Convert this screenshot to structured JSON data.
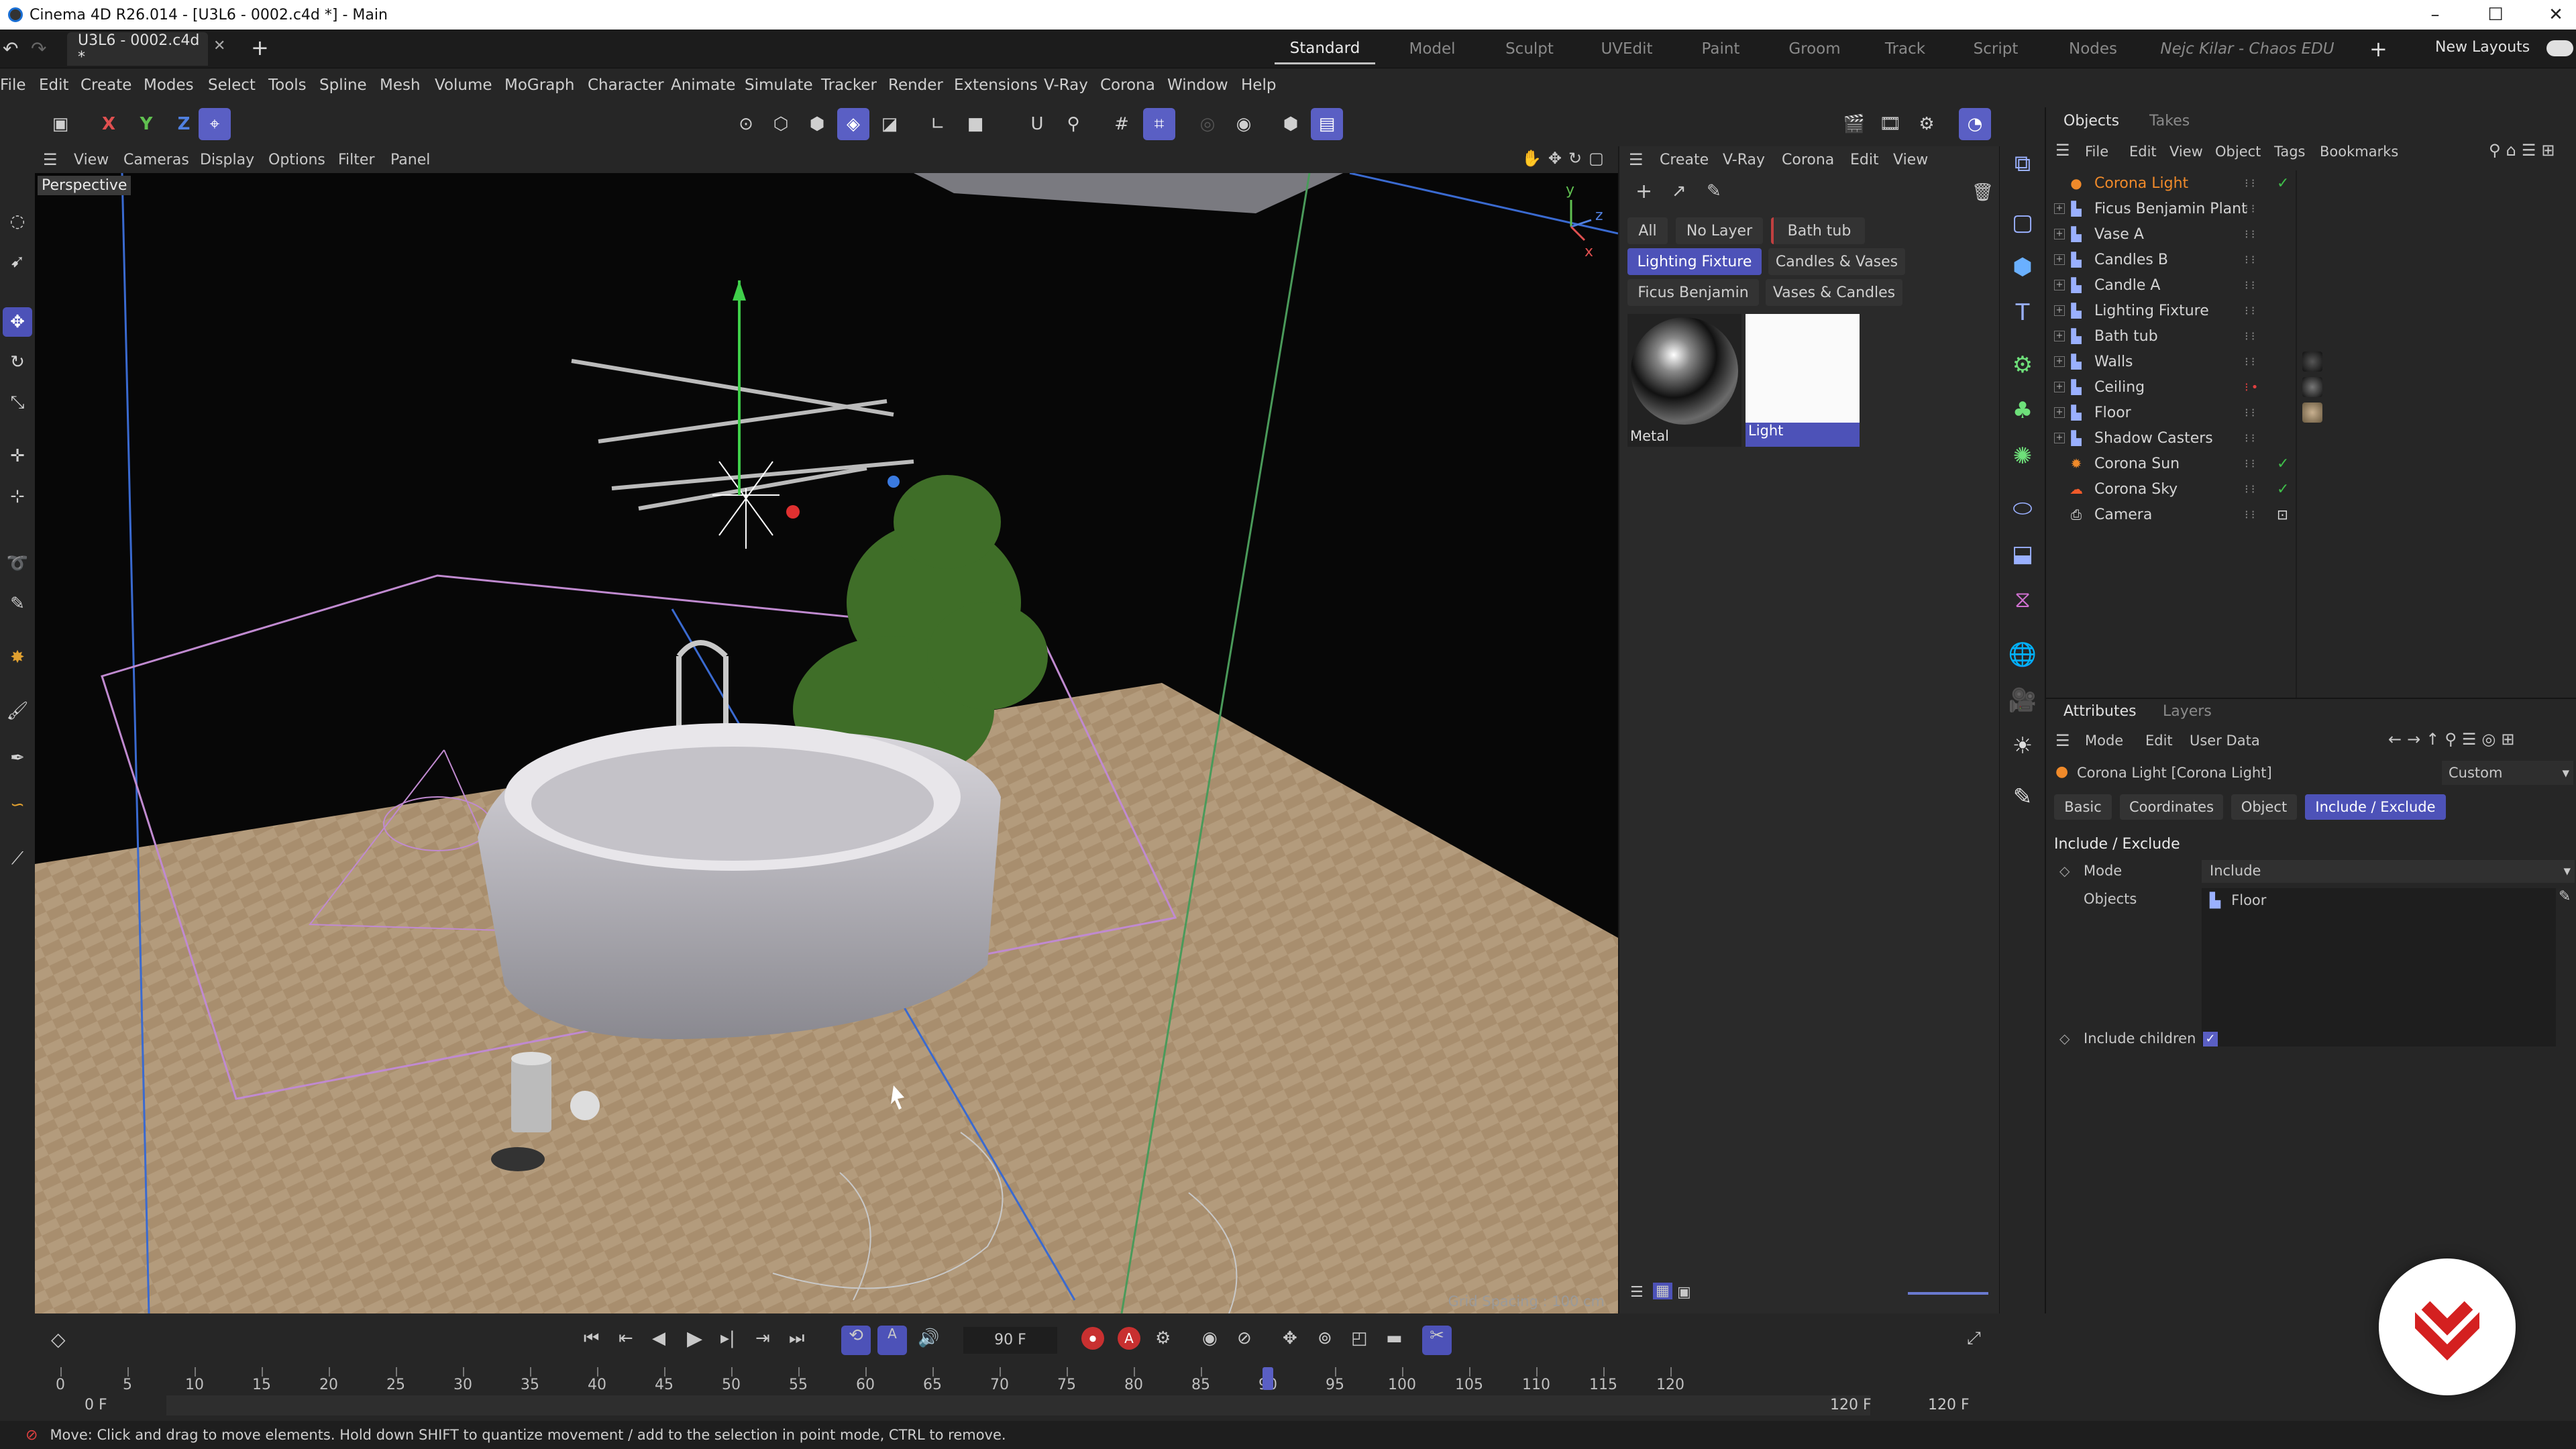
{
  "title": "Cinema 4D R26.014 - [U3L6 - 0002.c4d *] - Main",
  "doc_tab": "U3L6 - 0002.c4d *",
  "layout_tabs": [
    "Standard",
    "Model",
    "Sculpt",
    "UVEdit",
    "Paint",
    "Groom",
    "Track",
    "Script",
    "Nodes",
    "Nejc Kilar - Chaos EDU"
  ],
  "new_layouts": "New Layouts",
  "menus": [
    "File",
    "Edit",
    "Create",
    "Modes",
    "Select",
    "Tools",
    "Spline",
    "Mesh",
    "Volume",
    "MoGraph",
    "Character",
    "Animate",
    "Simulate",
    "Tracker",
    "Render",
    "Extensions",
    "V-Ray",
    "Corona",
    "Window",
    "Help"
  ],
  "axis": {
    "x": "X",
    "y": "Y",
    "z": "Z"
  },
  "viewport_menu": [
    "View",
    "Cameras",
    "Display",
    "Options",
    "Filter",
    "Panel"
  ],
  "viewport_label": "Perspective",
  "grid_spacing": "Grid Spacing : 100 cm",
  "mat_menu": [
    "Create",
    "V-Ray",
    "Corona",
    "Edit",
    "View"
  ],
  "layer_chips": [
    "All",
    "No Layer",
    "Bath tub",
    "Lighting Fixture",
    "Candles & Vases",
    "Ficus Benjamin",
    "Vases & Candles"
  ],
  "materials": [
    "Metal",
    "Light"
  ],
  "panel_tabs": {
    "objects": "Objects",
    "takes": "Takes",
    "attributes": "Attributes",
    "layers": "Layers"
  },
  "obj_menu": [
    "File",
    "Edit",
    "View",
    "Object",
    "Tags",
    "Bookmarks"
  ],
  "objects": [
    "Corona Light",
    "Ficus Benjamin Plant",
    "Vase A",
    "Candles B",
    "Candle A",
    "Lighting Fixture",
    "Bath tub",
    "Walls",
    "Ceiling",
    "Floor",
    "Shadow Casters",
    "Corona Sun",
    "Corona Sky",
    "Camera"
  ],
  "attr_menu": [
    "Mode",
    "Edit",
    "User Data"
  ],
  "attr_object": "Corona Light [Corona Light]",
  "attr_preset": "Custom",
  "attr_tabs": [
    "Basic",
    "Coordinates",
    "Object",
    "Include / Exclude"
  ],
  "section_title": "Include / Exclude",
  "mode_label": "Mode",
  "mode_value": "Include",
  "objects_label": "Objects",
  "objects_list": [
    "Floor"
  ],
  "include_children": "Include children",
  "include_children_checked": true,
  "timeline": {
    "current": "90 F",
    "start": "0 F",
    "start2": "0 F",
    "end": "120 F",
    "end2": "120 F",
    "current_frame": 90,
    "max_frame": 120,
    "ticks": [
      "0",
      "5",
      "10",
      "15",
      "20",
      "25",
      "30",
      "35",
      "40",
      "45",
      "50",
      "55",
      "60",
      "65",
      "70",
      "75",
      "80",
      "85",
      "90",
      "95",
      "100",
      "105",
      "110",
      "115",
      "120"
    ]
  },
  "status": "Move: Click and drag to move elements. Hold down SHIFT to quantize movement / add to the selection in point mode, CTRL to remove.",
  "colors": {
    "accent": "#5a5fc4",
    "selected_object": "#f08a2a",
    "check": "#3fbf4a"
  }
}
